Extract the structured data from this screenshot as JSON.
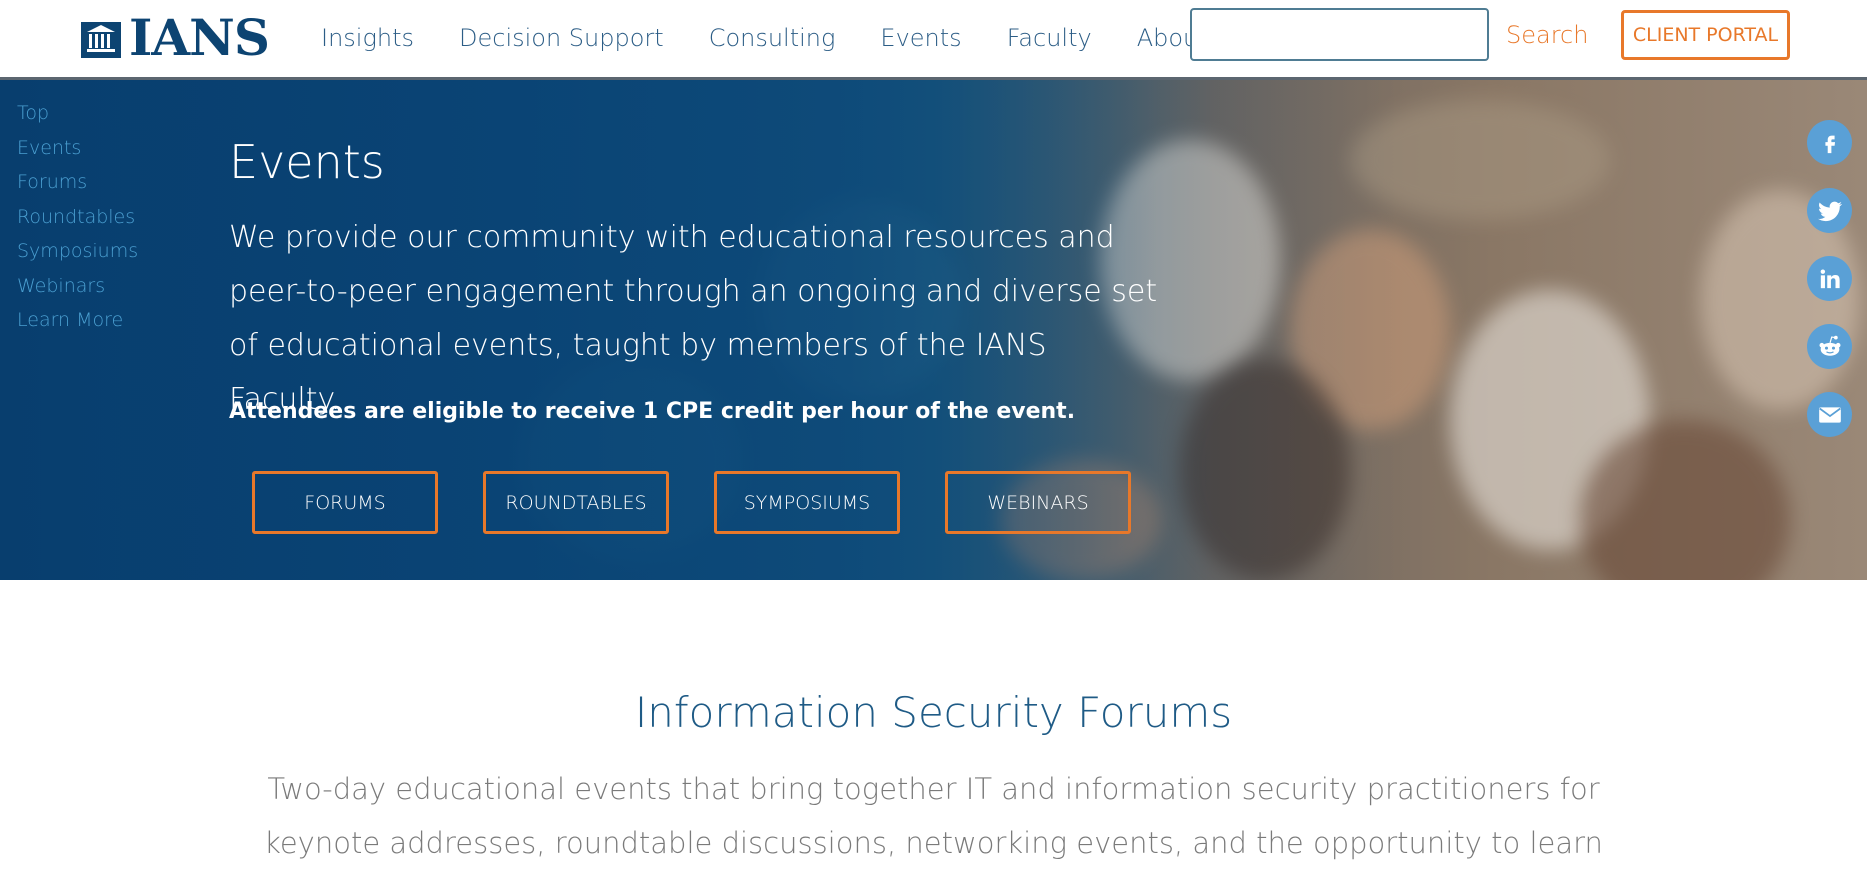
{
  "header": {
    "logo_text": "IANS",
    "nav": [
      "Insights",
      "Decision Support",
      "Consulting",
      "Events",
      "Faculty",
      "About"
    ],
    "search_value": "",
    "search_label": "Search",
    "portal_label": "CLIENT PORTAL"
  },
  "sidebar": {
    "items": [
      "Top",
      "Events",
      "Forums",
      "Roundtables",
      "Symposiums",
      "Webinars",
      "Learn More"
    ]
  },
  "hero": {
    "title": "Events",
    "description": "We provide our community with educational resources and peer-to-peer engagement through an ongoing and diverse set of educational events, taught by members of the IANS Faculty.",
    "note": "Attendees are eligible to receive 1 CPE credit per hour of the event.",
    "buttons": [
      "FORUMS",
      "ROUNDTABLES",
      "SYMPOSIUMS",
      "WEBINARS"
    ]
  },
  "social": [
    "facebook-icon",
    "twitter-icon",
    "linkedin-icon",
    "reddit-icon",
    "email-icon"
  ],
  "section": {
    "title": "Information Security Forums",
    "description": "Two-day educational events that bring together IT and information security practitioners for keynote addresses, roundtable discussions, networking events, and the opportunity to learn about new"
  },
  "colors": {
    "brand_navy": "#0d4472",
    "accent_orange": "#e8782a",
    "nav_blue": "#2c5d86",
    "sidebar_link": "#4a9fd1",
    "social_blue": "#5aa0d6"
  }
}
